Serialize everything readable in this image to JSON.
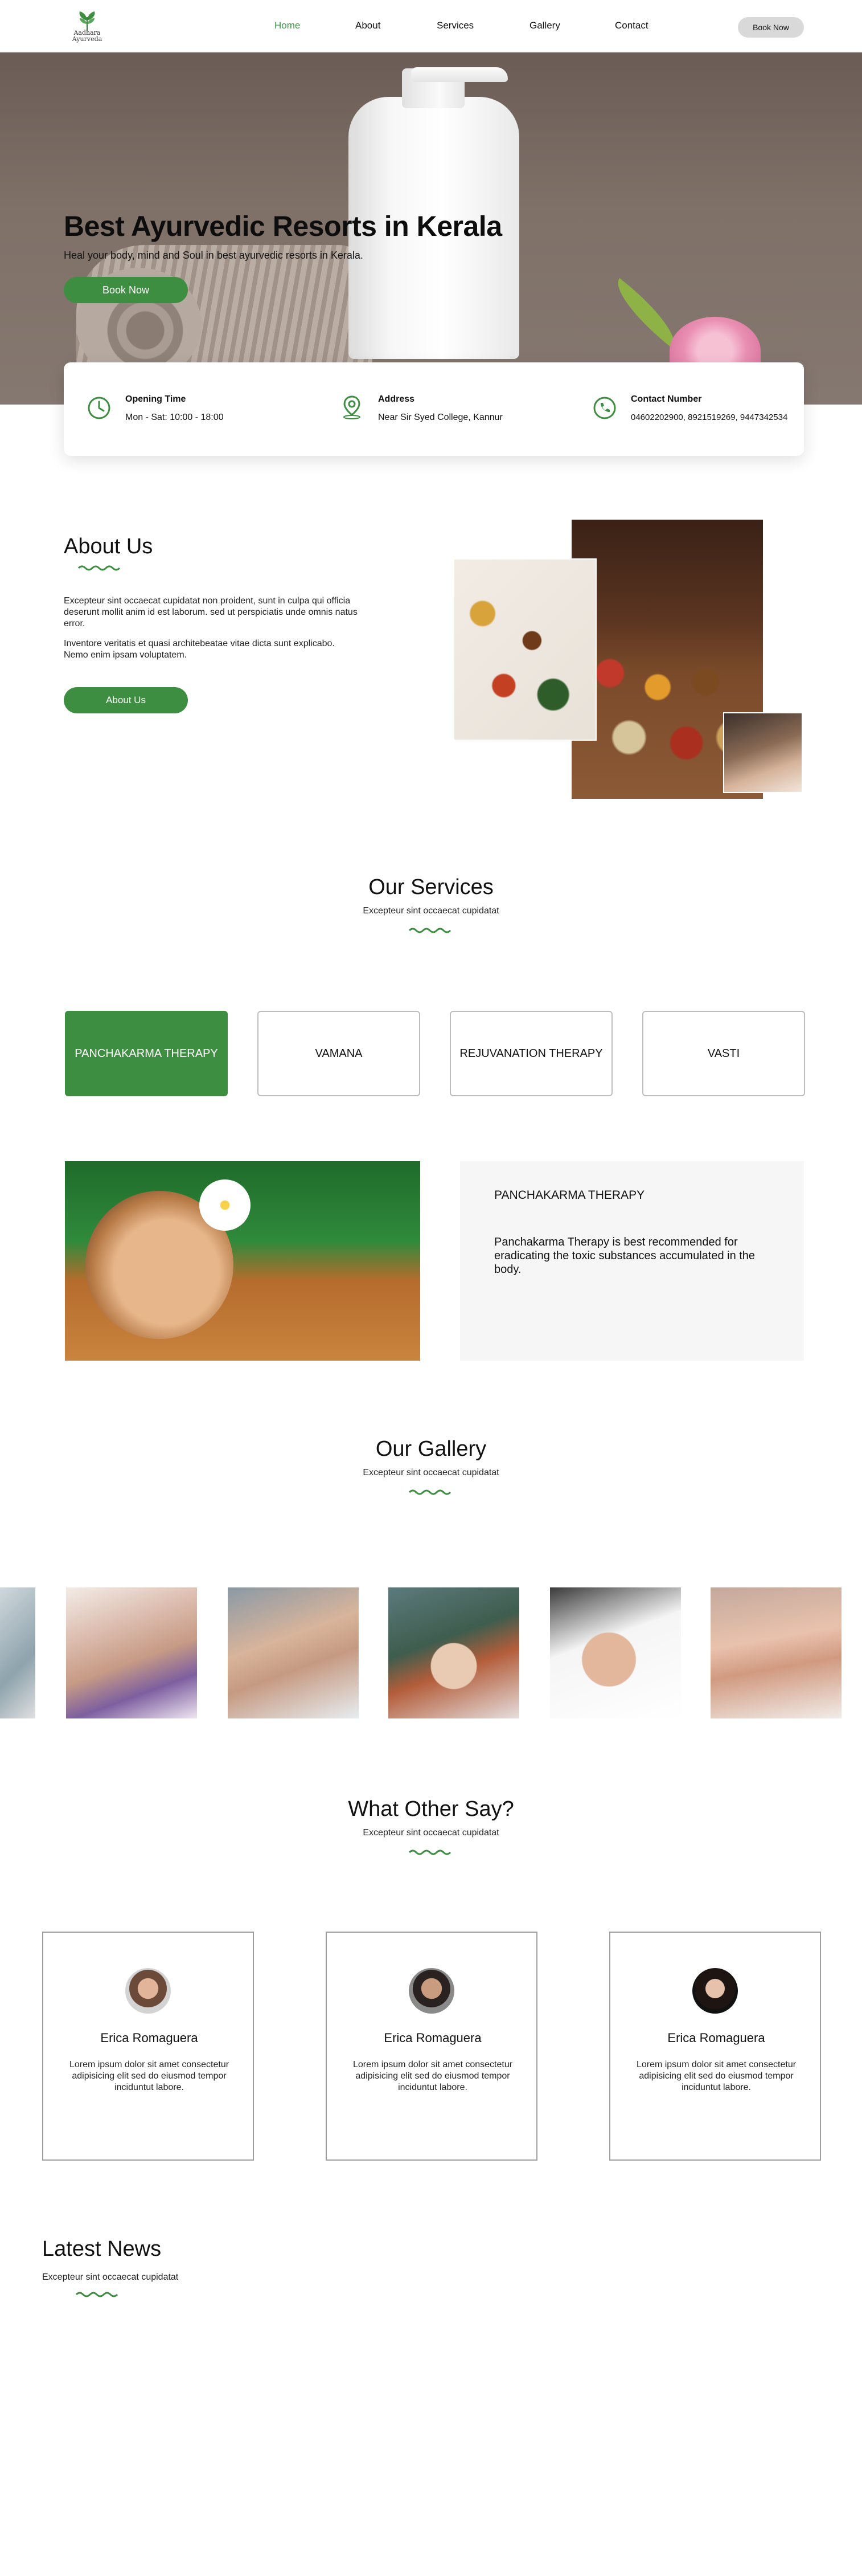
{
  "nav": {
    "logo_text_line1": "Aadhara",
    "logo_text_line2": "Ayurveda",
    "links": [
      "Home",
      "About",
      "Services",
      "Gallery",
      "Contact"
    ],
    "active": "Home",
    "book_label": "Book Now"
  },
  "hero": {
    "title": "Best Ayurvedic Resorts in Kerala",
    "subtitle": "Heal your body, mind and Soul in best ayurvedic resorts in Kerala.",
    "button": "Book Now"
  },
  "info": {
    "hours_label": "Opening Time",
    "hours_value": "Mon - Sat: 10:00 - 18:00",
    "address_label": "Address",
    "address_value": "Near Sir Syed College, Kannur",
    "contact_label": "Contact Number",
    "contact_value": "04602202900, 8921519269, 9447342534"
  },
  "about": {
    "title": "About Us",
    "p1": "Excepteur sint occaecat cupidatat non proident, sunt in culpa qui officia deserunt mollit anim id est laborum. sed ut perspiciatis unde omnis natus error.",
    "p2": "Inventore veritatis et quasi architebeatae vitae dicta sunt explicabo. Nemo enim ipsam voluptatem.",
    "button": "About Us"
  },
  "services": {
    "title": "Our Services",
    "subtitle": "Excepteur sint occaecat cupidatat",
    "tabs": [
      "PANCHAKARMA THERAPY",
      "VAMANA",
      "REJUVANATION THERAPY",
      "VASTI"
    ],
    "active_tab": "PANCHAKARMA THERAPY",
    "detail_title": "PANCHAKARMA THERAPY",
    "detail_desc": "Panchakarma Therapy is best recommended for eradicating the toxic substances accumulated in the body."
  },
  "gallery": {
    "title": "Our Gallery",
    "subtitle": "Excepteur sint occaecat cupidatat"
  },
  "testimonials": {
    "title": "What Other Say?",
    "subtitle": "Excepteur sint occaecat cupidatat",
    "items": [
      {
        "name": "Erica Romaguera",
        "text": "Lorem ipsum dolor sit amet consectetur adipisicing elit sed do eiusmod tempor inciduntut labore."
      },
      {
        "name": "Erica Romaguera",
        "text": "Lorem ipsum dolor sit amet consectetur adipisicing elit sed do eiusmod tempor inciduntut labore."
      },
      {
        "name": "Erica Romaguera",
        "text": "Lorem ipsum dolor sit amet consectetur adipisicing elit sed do eiusmod tempor inciduntut labore."
      }
    ]
  },
  "news": {
    "title": "Latest News",
    "subtitle": "Excepteur sint occaecat cupidatat"
  },
  "colors": {
    "accent": "#3e8e41",
    "nav_active": "#3b9b45",
    "button_grey": "#d9d9d9",
    "card_bg": "#f6f6f6"
  }
}
